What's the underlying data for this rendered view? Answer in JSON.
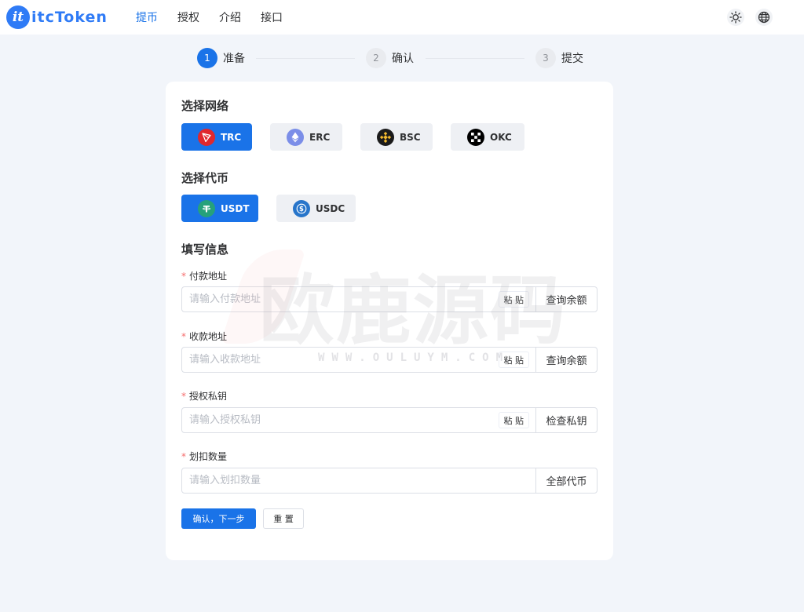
{
  "header": {
    "logo_badge": "it",
    "logo_text": "itcToken",
    "nav": [
      "提币",
      "授权",
      "介绍",
      "接口"
    ],
    "theme_icon": "sun-icon",
    "language_icon": "globe-icon"
  },
  "steps": [
    {
      "num": "1",
      "label": "准备",
      "active": true
    },
    {
      "num": "2",
      "label": "确认",
      "active": false
    },
    {
      "num": "3",
      "label": "提交",
      "active": false
    }
  ],
  "network": {
    "title": "选择网络",
    "options": [
      {
        "label": "TRC",
        "icon": "tron-icon",
        "active": true
      },
      {
        "label": "ERC",
        "icon": "ethereum-icon",
        "active": false
      },
      {
        "label": "BSC",
        "icon": "bnb-icon",
        "active": false
      },
      {
        "label": "OKC",
        "icon": "okx-icon",
        "active": false
      }
    ]
  },
  "token": {
    "title": "选择代币",
    "options": [
      {
        "label": "USDT",
        "icon": "tether-icon",
        "active": true
      },
      {
        "label": "USDC",
        "icon": "usdc-icon",
        "active": false
      }
    ]
  },
  "form": {
    "title": "填写信息",
    "required_mark": "*",
    "paste_label": "粘 贴",
    "fields": [
      {
        "label": "付款地址",
        "placeholder": "请输入付款地址",
        "value": "",
        "action": "查询余额"
      },
      {
        "label": "收款地址",
        "placeholder": "请输入收款地址",
        "value": "",
        "action": "查询余额"
      },
      {
        "label": "授权私钥",
        "placeholder": "请输入授权私钥",
        "value": "",
        "action": "检查私钥"
      },
      {
        "label": "划扣数量",
        "placeholder": "请输入划扣数量",
        "value": "",
        "action": "全部代币"
      }
    ],
    "submit_label": "确认，下一步",
    "reset_label": "重 置"
  },
  "watermark": {
    "main": "欧鹿源码",
    "sub": "WWW.OULUYM.COM"
  },
  "colors": {
    "primary": "#1a73e8",
    "background": "#f2f5fa",
    "chip": "#eef0f4",
    "required": "#f56c6c"
  }
}
